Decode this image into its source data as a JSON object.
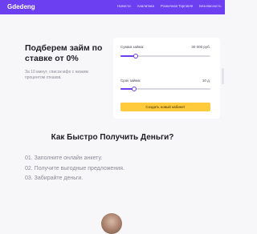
{
  "header": {
    "logo": "Gdedeng",
    "nav": [
      "Новости",
      "Аналитика",
      "Розничная Торговля",
      "Безопасность"
    ]
  },
  "hero": {
    "title": "Подберем займ по ставке от 0%",
    "subtitle": "За 10 минут, список мфо с низким процентом отказов."
  },
  "calculator": {
    "amount_label": "Сумма займа:",
    "amount_value": "30 000 руб.",
    "amount_fraction": 0.17,
    "term_label": "Срок займа:",
    "term_value": "10 д.",
    "term_fraction": 0.15,
    "cta_label": "Создать новый кабинет"
  },
  "how": {
    "title": "Как Быстро Получить Деньги?",
    "steps": [
      "01. Заполните онлайн анкету.",
      "02. Получите выгодные предложения.",
      "03. Забирайте деньги."
    ]
  },
  "colors": {
    "brand": "#6c3ff0",
    "cta": "#ffcb3d"
  }
}
